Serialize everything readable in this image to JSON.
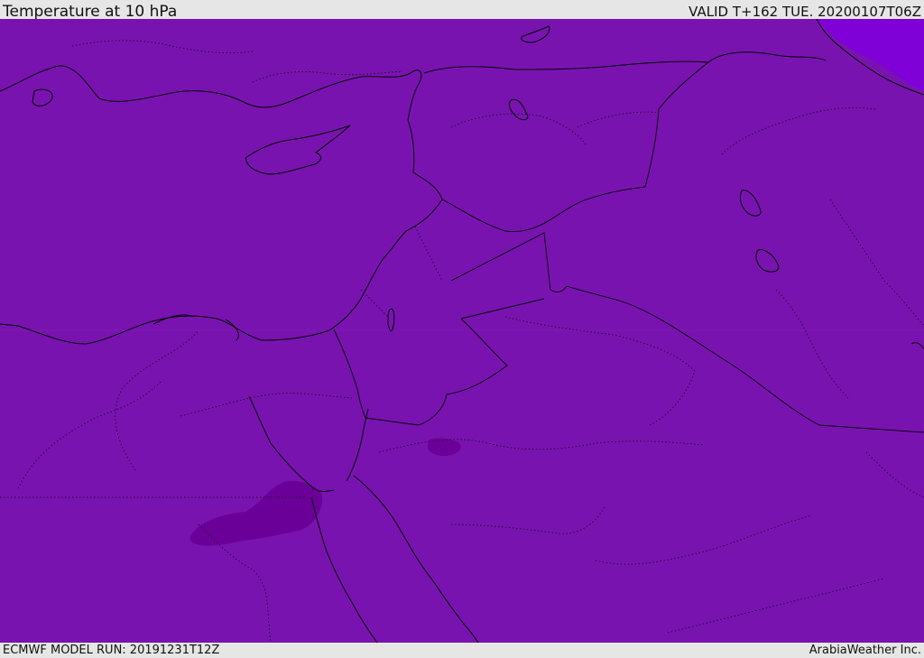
{
  "header": {
    "title": "Temperature at 10 hPa",
    "valid": "VALID T+162 TUE. 20200107T06Z"
  },
  "footer": {
    "model_run": "ECMWF MODEL RUN: 20191231T12Z",
    "credit": "ArabiaWeather Inc."
  },
  "colors": {
    "field_base": "#7913b0",
    "field_cold_corner": "#8000d8",
    "field_warm_blob": "#6b0099",
    "coastline": "#000000",
    "border": "#000000",
    "bar_background": "#e6e6e6"
  }
}
